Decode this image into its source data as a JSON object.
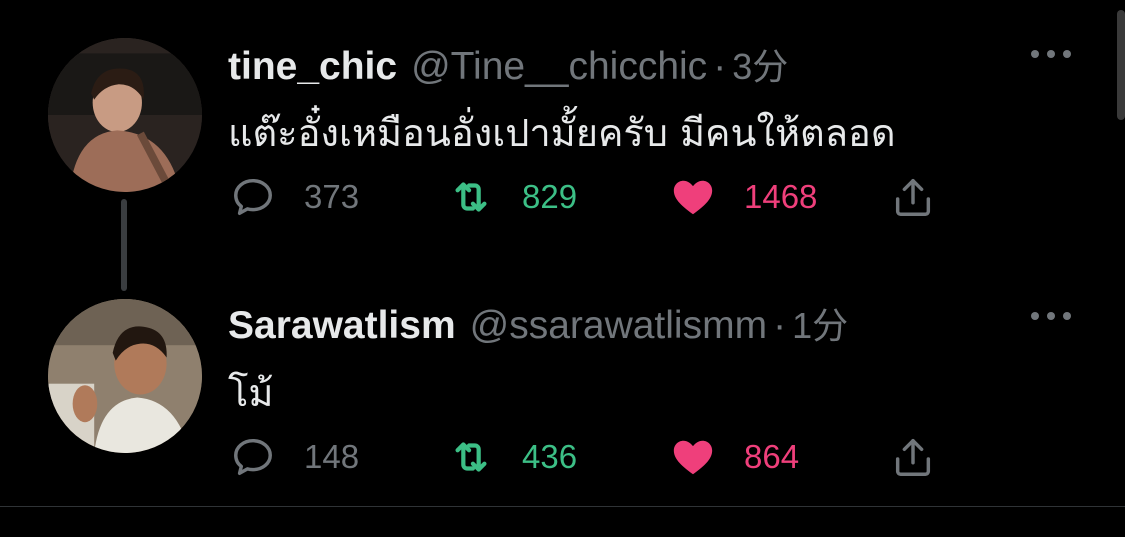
{
  "tweets": [
    {
      "name": "tine_chic",
      "handle": "@Tine__chicchic",
      "separator": "·",
      "time": "3分",
      "text": "แต๊ะอั๋งเหมือนอั่งเปามั้ยครับ มีคนให้ตลอด",
      "replies": "373",
      "retweets": "829",
      "likes": "1468"
    },
    {
      "name": "Sarawatlism",
      "handle": "@ssarawatlismm",
      "separator": "·",
      "time": "1分",
      "text": "โม้",
      "replies": "148",
      "retweets": "436",
      "likes": "864"
    }
  ],
  "colors": {
    "background": "#000000",
    "retweet": "#3cbf86",
    "like": "#ef3f7b",
    "muted": "#71767b"
  },
  "icons": [
    "avatar",
    "more-icon",
    "reply-icon",
    "retweet-icon",
    "like-icon",
    "share-icon"
  ]
}
